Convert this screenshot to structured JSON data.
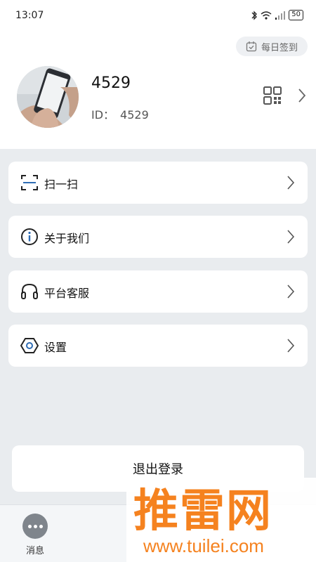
{
  "status_bar": {
    "time": "13:07",
    "battery": "50"
  },
  "header": {
    "checkin_label": "每日签到"
  },
  "profile": {
    "name": "4529",
    "id_label": "ID：",
    "id_value": "4529"
  },
  "menu": [
    {
      "label": "扫一扫",
      "icon": "scan-icon"
    },
    {
      "label": "关于我们",
      "icon": "info-icon"
    },
    {
      "label": "平台客服",
      "icon": "headset-icon"
    },
    {
      "label": "设置",
      "icon": "settings-icon"
    }
  ],
  "logout_label": "退出登录",
  "bottom_nav": {
    "messages_label": "消息"
  },
  "watermark": {
    "main": "推雷网",
    "url": "www.tuilei.com"
  },
  "colors": {
    "scan_accent": "#2f6db5",
    "watermark": "#f5821f",
    "page_bg": "#e9ecef"
  }
}
